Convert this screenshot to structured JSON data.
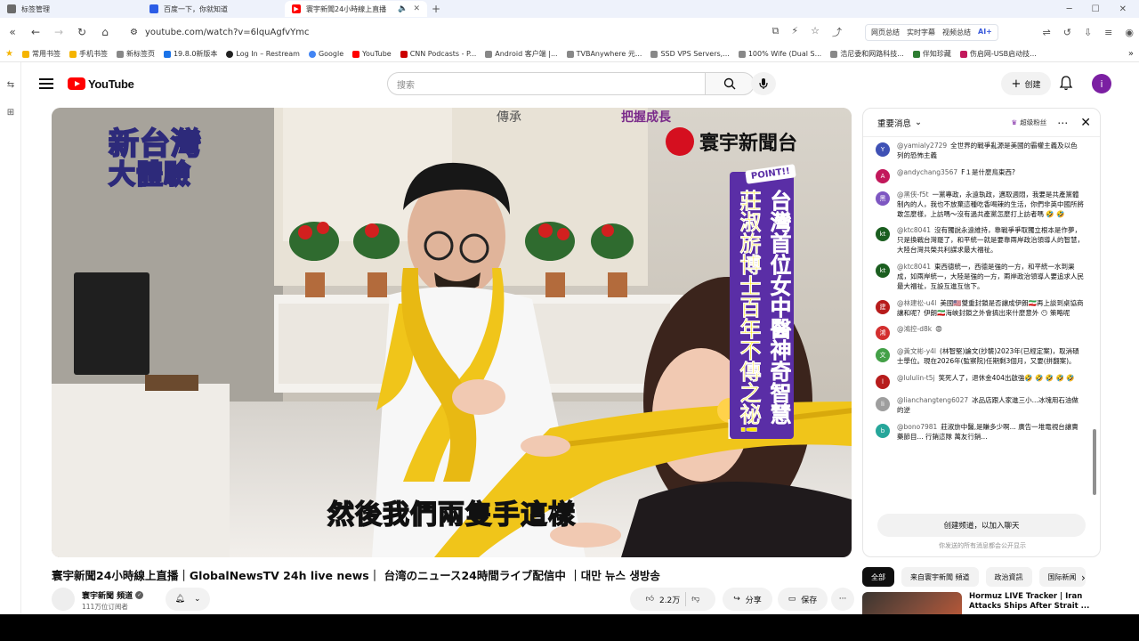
{
  "browser": {
    "tabs": [
      {
        "label": "标签管理",
        "active": false,
        "icon_color": "#6b6b6b"
      },
      {
        "label": "百度一下，你就知道",
        "active": false,
        "icon_color": "#2b5ce6"
      },
      {
        "label": "寰宇新聞24小時線上直播",
        "active": true,
        "icon_color": "#ff0000"
      }
    ],
    "url": "youtube.com/watch?v=6lquAgfvYmc",
    "extensions": [
      "网页总结",
      "实时字幕",
      "视频总结",
      "AI+"
    ],
    "bookmarks": [
      {
        "label": "常用书签",
        "color": "#f5b400"
      },
      {
        "label": "手机书签",
        "color": "#f5b400"
      },
      {
        "label": "新标签页",
        "color": "#888888"
      },
      {
        "label": "19.8.0新版本",
        "color": "#1a73e8"
      },
      {
        "label": "Log In – Restream",
        "color": "#222222"
      },
      {
        "label": "Google",
        "color": "#4285f4"
      },
      {
        "label": "YouTube",
        "color": "#ff0000"
      },
      {
        "label": "CNN Podcasts - P...",
        "color": "#cc0000"
      },
      {
        "label": "Android 客户端 |...",
        "color": "#888888"
      },
      {
        "label": "TVBAnywhere 元...",
        "color": "#888888"
      },
      {
        "label": "SSD VPS Servers,...",
        "color": "#888888"
      },
      {
        "label": "100% Wife (Dual S...",
        "color": "#888888"
      },
      {
        "label": "浩尼委和网路科技...",
        "color": "#888888"
      },
      {
        "label": "伴知珍藏",
        "color": "#2e7d32"
      },
      {
        "label": "伤启网-USB启动技...",
        "color": "#c2185b"
      }
    ]
  },
  "youtube": {
    "logo_text": "YouTube",
    "search_placeholder": "搜索",
    "create_label": "创建",
    "avatar_letter": "i"
  },
  "video": {
    "show_title_line1": "新台灣",
    "show_title_line2": "大體驗",
    "channel_logo_text": "寰宇新聞台",
    "point_tag": "POINT!!",
    "vertical_caption_col1": "台灣首位女中醫神奇智慧",
    "vertical_caption_col2": "莊淑旂博士百年不傳之祕!",
    "top_strip_left": "傳承",
    "top_strip_right": "把握成長",
    "subtitle": "然後我們兩隻手這樣",
    "title": "寰宇新聞24小時線上直播｜GlobalNewsTV 24h live news｜ 台湾のニュース24時間ライブ配信中 ｜대만 뉴스 생방송",
    "channel_name": "寰宇新聞 頻道",
    "subscribers": "111万位订阅者",
    "likes": "2.2万",
    "share_label": "分享",
    "save_label": "保存"
  },
  "chat": {
    "mode_label": "重要消息",
    "super_label": "超级粉丝",
    "messages": [
      {
        "initial": "Y",
        "color": "#3f51b5",
        "author": "@yamialy2729",
        "text": "全世界的戰爭亂源是美國的霸權主義及以色列的恐怖主義"
      },
      {
        "initial": "A",
        "color": "#c2185b",
        "author": "@andychang3567",
        "text": "F１是什麼鳥東西?"
      },
      {
        "initial": "黑",
        "color": "#7e57c2",
        "author": "@黑侠-f5t",
        "text": "一黨專政，永遠執政，邁取週悶，我要是共產黨體制內的人，我也不放棄這種吃香喝辣的生活，你們非英中國所將敢怎麼樣，上訪嗎～沒有過共產黨怎麼打上訪者嗎 🤣 🤣"
      },
      {
        "initial": "kt",
        "color": "#1b5e20",
        "author": "@ktc8041",
        "text": "沒有獨說永遠維持，靠戰爭爭取獨立根本是作夢，只是換戰台灣罷了，和平統一就是要靠兩岸政治領導人的智慧，大陸台灣共榮共利謀求最大福祉。"
      },
      {
        "initial": "kt",
        "color": "#1b5e20",
        "author": "@ktc8041",
        "text": "東西德統一，西德是強的一方，和平統一水到渠成，如兩岸統一，大陸是強的一方，兩岸政治領導人要追求人民最大福祉，互設互進互信下。"
      },
      {
        "initial": "建",
        "color": "#b71c1c",
        "author": "@林建松-u4l",
        "text": "美國🇺🇸雙重封鎖是否讓成伊朗🇮🇷再上談到桌協商讓和呢？伊朗🇮🇷海峽封鎖之外會搞出來什麼意外 😶 策略呢"
      },
      {
        "initial": "鴻",
        "color": "#d32f2f",
        "author": "@鴻控-d8k",
        "text": "😡"
      },
      {
        "initial": "文",
        "color": "#43a047",
        "author": "@黃文彬-y4l",
        "text": "(林智堅)論文(抄襲)2023年(已經定案)，取消碩士學位。現在2026年(監察院)任期剩3個月，又要(拼翻案)。"
      },
      {
        "initial": "l",
        "color": "#b71c1c",
        "author": "@lululin-t5j",
        "text": "笑死人了，退休金404出啟強🤣 🤣 🤣 🤣 🤣"
      },
      {
        "initial": "li",
        "color": "#9e9e9e",
        "author": "@lianchangteng6027",
        "text": "冰品店跟人家進三小...冰塊用石油做的逆"
      },
      {
        "initial": "b",
        "color": "#26a69a",
        "author": "@bono7981",
        "text": "莊淑旂中醫,是賺多少啊... 廣告一堆電視台讓賣藥節目... 行銷這隊 萬友行銷..."
      }
    ],
    "join_label": "创建频道，以加入聊天",
    "note": "你发送的所有消息都会公开显示"
  },
  "chips": [
    "全部",
    "来自寰宇新聞 頻道",
    "政治資訊",
    "国际新闻"
  ],
  "recommendation": {
    "title": "Hormuz LIVE Tracker | Iran Attacks Ships After Strait ..."
  }
}
